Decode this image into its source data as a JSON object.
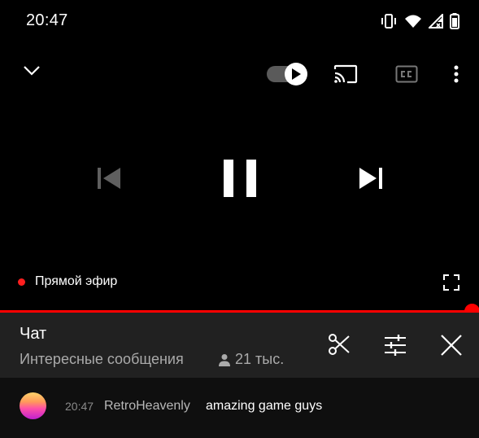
{
  "status_bar": {
    "time": "20:47"
  },
  "player": {
    "live_label": "Прямой эфир",
    "autoplay_on": true,
    "progress": 0.98
  },
  "chat": {
    "title": "Чат",
    "mode": "Интересные сообщения",
    "viewers": "21 тыс.",
    "messages": [
      {
        "time": "20:47",
        "author": "RetroHeavenly",
        "text": "amazing game guys"
      }
    ]
  },
  "colors": {
    "live_red": "#ff0000",
    "header_bg": "#212121",
    "chat_bg": "#0f0f0f",
    "secondary_text": "#aaaaaa"
  },
  "icons": [
    "vibrate-icon",
    "wifi-icon",
    "cellular-signal-icon",
    "battery-icon",
    "chevron-down-icon",
    "autoplay-toggle",
    "cast-icon",
    "captions-icon",
    "more-vert-icon",
    "skip-previous-icon",
    "pause-icon",
    "skip-next-icon",
    "fullscreen-icon",
    "person-icon",
    "clip-scissors-icon",
    "filter-sliders-icon",
    "close-icon"
  ]
}
